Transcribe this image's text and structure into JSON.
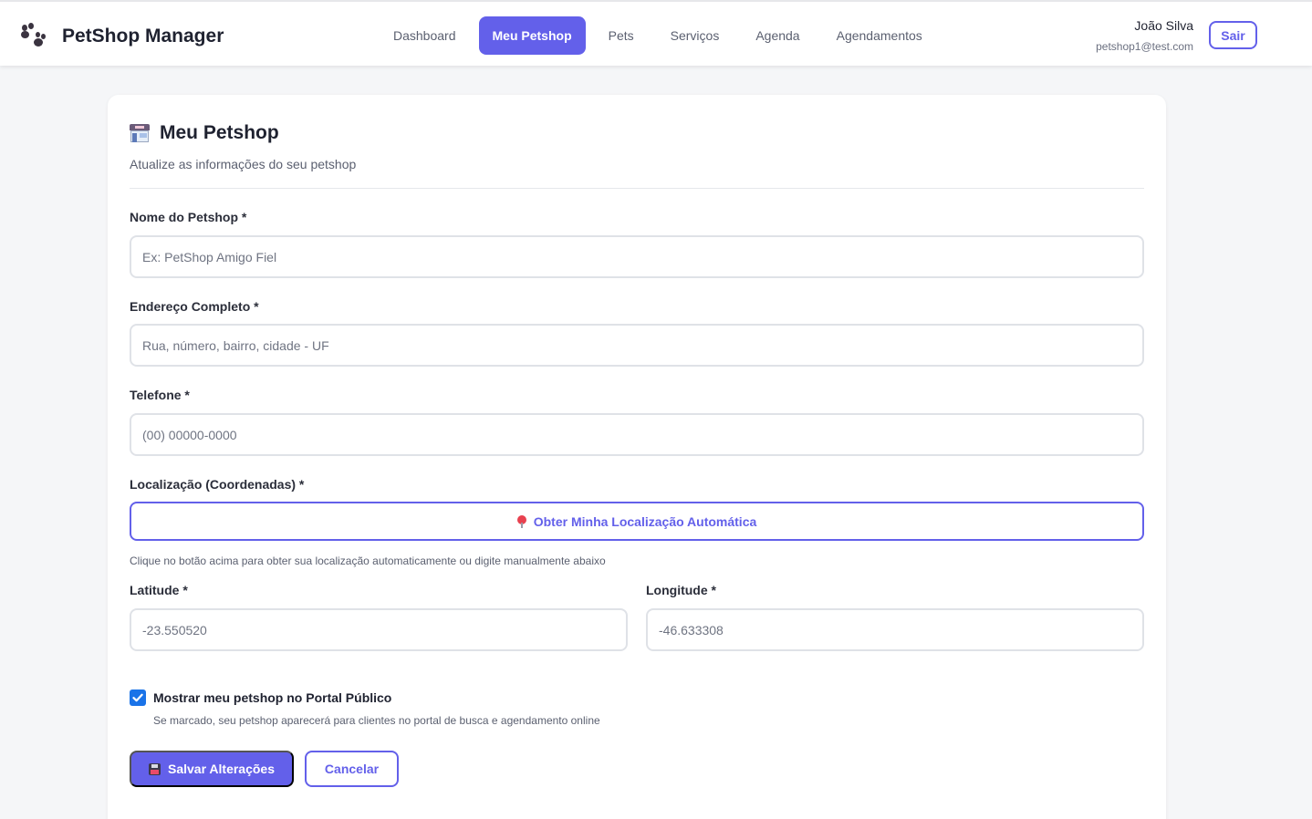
{
  "app": {
    "title": "PetShop Manager",
    "logo_icon": "paw-prints-icon"
  },
  "nav": {
    "items": [
      {
        "label": "Dashboard",
        "active": false
      },
      {
        "label": "Meu Petshop",
        "active": true
      },
      {
        "label": "Pets",
        "active": false
      },
      {
        "label": "Serviços",
        "active": false
      },
      {
        "label": "Agenda",
        "active": false
      },
      {
        "label": "Agendamentos",
        "active": false
      }
    ]
  },
  "user": {
    "name": "João Silva",
    "email": "petshop1@test.com",
    "logout_label": "Sair"
  },
  "page": {
    "title": "Meu Petshop",
    "title_icon": "store-icon",
    "subtitle": "Atualize as informações do seu petshop"
  },
  "form": {
    "name": {
      "label": "Nome do Petshop *",
      "value": "",
      "placeholder": "Ex: PetShop Amigo Fiel"
    },
    "address": {
      "label": "Endereço Completo *",
      "value": "",
      "placeholder": "Rua, número, bairro, cidade - UF"
    },
    "phone": {
      "label": "Telefone *",
      "value": "",
      "placeholder": "(00) 00000-0000"
    },
    "location": {
      "label": "Localização (Coordenadas) *",
      "button_label": "Obter Minha Localização Automática",
      "button_icon": "location-pin-icon",
      "hint": "Clique no botão acima para obter sua localização automaticamente ou digite manualmente abaixo"
    },
    "latitude": {
      "label": "Latitude *",
      "value": "",
      "placeholder": "-23.550520"
    },
    "longitude": {
      "label": "Longitude *",
      "value": "",
      "placeholder": "-46.633308"
    },
    "public_portal": {
      "checked": true,
      "label": "Mostrar meu petshop no Portal Público",
      "hint": "Se marcado, seu petshop aparecerá para clientes no portal de busca e agendamento online"
    },
    "save_label": "Salvar Alterações",
    "save_icon": "floppy-disk-icon",
    "cancel_label": "Cancelar"
  },
  "colors": {
    "accent": "#6360ea",
    "background": "#f5f6f8",
    "checkbox": "#1a73e8"
  }
}
